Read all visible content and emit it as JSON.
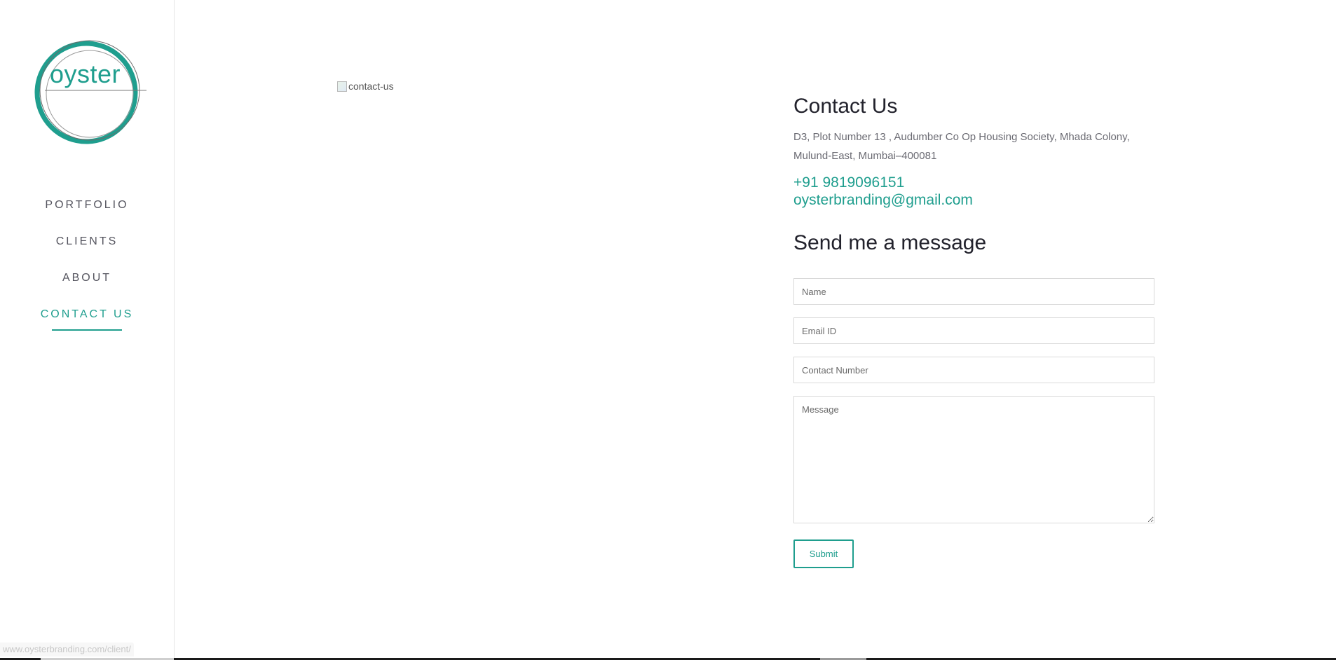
{
  "brand": {
    "logo_text": "oyster",
    "accent_color": "#1f9e8e"
  },
  "nav": {
    "items": [
      {
        "label": "PORTFOLIO",
        "active": false
      },
      {
        "label": "CLIENTS",
        "active": false
      },
      {
        "label": "ABOUT",
        "active": false
      },
      {
        "label": "CONTACT US",
        "active": true
      }
    ]
  },
  "hero_image": {
    "alt": "contact-us",
    "icon": "broken-image-icon"
  },
  "contact": {
    "title": "Contact Us",
    "address_line1": "D3, Plot Number 13 , Audumber Co Op Housing Society, Mhada Colony,",
    "address_line2": "Mulund-East, Mumbai–400081",
    "phone": "+91 9819096151",
    "email": "oysterbranding@gmail.com"
  },
  "form": {
    "heading": "Send me a message",
    "name_placeholder": "Name",
    "email_placeholder": "Email ID",
    "phone_placeholder": "Contact Number",
    "message_placeholder": "Message",
    "submit_label": "Submit"
  },
  "status_bar": {
    "url": "www.oysterbranding.com/client/"
  }
}
